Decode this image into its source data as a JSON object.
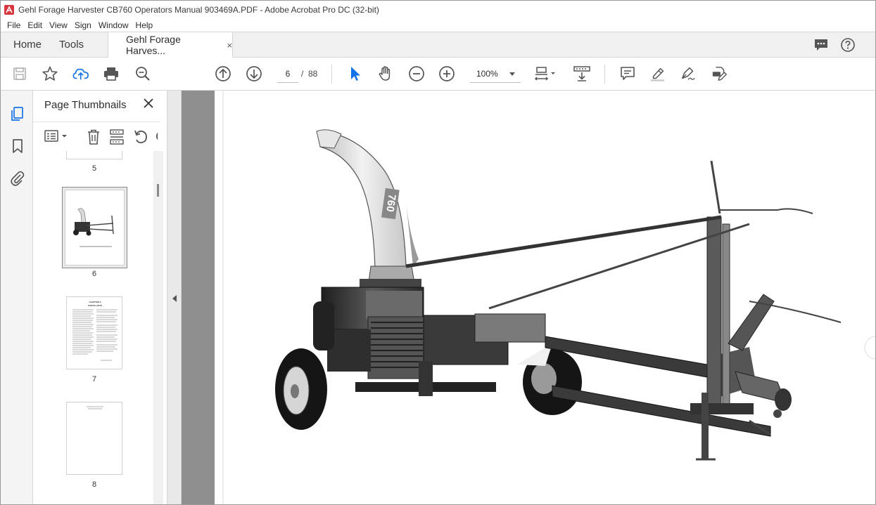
{
  "window": {
    "title": "Gehl Forage Harvester CB760 Operators Manual 903469A.PDF - Adobe Acrobat Pro DC (32-bit)",
    "accent_color": "#d7373f"
  },
  "menubar": {
    "items": [
      {
        "label": "File"
      },
      {
        "label": "Edit"
      },
      {
        "label": "View"
      },
      {
        "label": "Sign"
      },
      {
        "label": "Window"
      },
      {
        "label": "Help"
      }
    ]
  },
  "tabs": {
    "home_label": "Home",
    "tools_label": "Tools",
    "document_tab_label": "Gehl Forage Harves...",
    "document_tab_close": "×"
  },
  "toolbar": {
    "current_page": "6",
    "page_separator": "/",
    "total_pages": "88",
    "zoom": "100%",
    "icons": [
      "save-icon",
      "star-icon",
      "upload-cloud-icon",
      "print-icon",
      "zoom-search-icon",
      "page-up-icon",
      "page-down-icon",
      "select-cursor-icon",
      "hand-icon",
      "zoom-out-icon",
      "zoom-in-icon",
      "fit-page-icon",
      "scroll-mode-icon",
      "comment-icon",
      "highlight-icon",
      "sign-icon",
      "edit-pdf-icon"
    ],
    "active_color": "#1473e6"
  },
  "left_rail": {
    "icons": [
      "page-thumbnails-icon",
      "bookmark-icon",
      "attachment-icon"
    ]
  },
  "thumbnails_panel": {
    "title": "Page Thumbnails",
    "close": "×",
    "pages": [
      {
        "label": "5"
      },
      {
        "label": "6",
        "selected": true
      },
      {
        "label": "7"
      },
      {
        "label": "8"
      }
    ],
    "thumb7_heading": "CHAPTER 3",
    "thumb7_subheading": "CHECK LISTS"
  },
  "document": {
    "chute_text": "760"
  }
}
